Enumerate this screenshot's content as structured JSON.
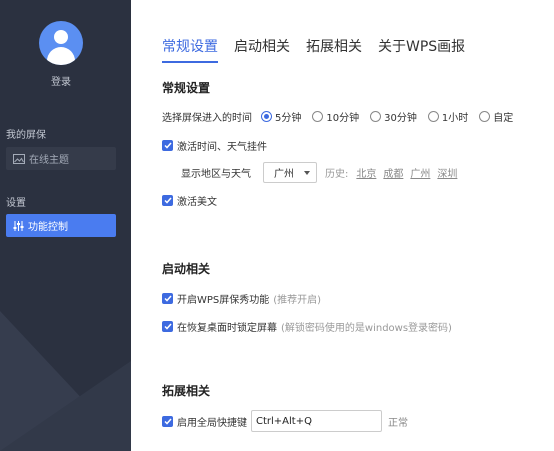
{
  "sidebar": {
    "login_label": "登录",
    "section_my_screensaver": "我的屏保",
    "online_theme_label": "在线主题",
    "section_settings": "设置",
    "feature_control_label": "功能控制"
  },
  "tabs": [
    "常规设置",
    "启动相关",
    "拓展相关",
    "关于WPS画报"
  ],
  "general": {
    "heading": "常规设置",
    "enter_time_label": "选择屏保进入的时间",
    "time_options": [
      {
        "label": "5分钟",
        "selected": true
      },
      {
        "label": "10分钟",
        "selected": false
      },
      {
        "label": "30分钟",
        "selected": false
      },
      {
        "label": "1小时",
        "selected": false
      },
      {
        "label": "自定",
        "selected": false
      }
    ],
    "activate_time_weather": "激活时间、天气挂件",
    "show_region_label": "显示地区与天气",
    "region_value": "广州",
    "history_label": "历史:",
    "history_cities": [
      "北京",
      "成都",
      "广州",
      "深圳"
    ],
    "activate_article": "激活美文"
  },
  "startup": {
    "heading": "启动相关",
    "enable_label": "开启WPS屏保秀功能",
    "enable_hint": "(推荐开启)",
    "lock_label": "在恢复桌面时锁定屏幕",
    "lock_hint": "(解锁密码使用的是windows登录密码)"
  },
  "extension": {
    "heading": "拓展相关",
    "hotkey_label": "启用全局快捷键",
    "hotkey_value": "Ctrl+Alt+Q",
    "hotkey_status": "正常"
  },
  "colors": {
    "accent": "#3d6ae0",
    "sidebar_bg": "#2b3140",
    "active_item": "#4a7cf0"
  }
}
